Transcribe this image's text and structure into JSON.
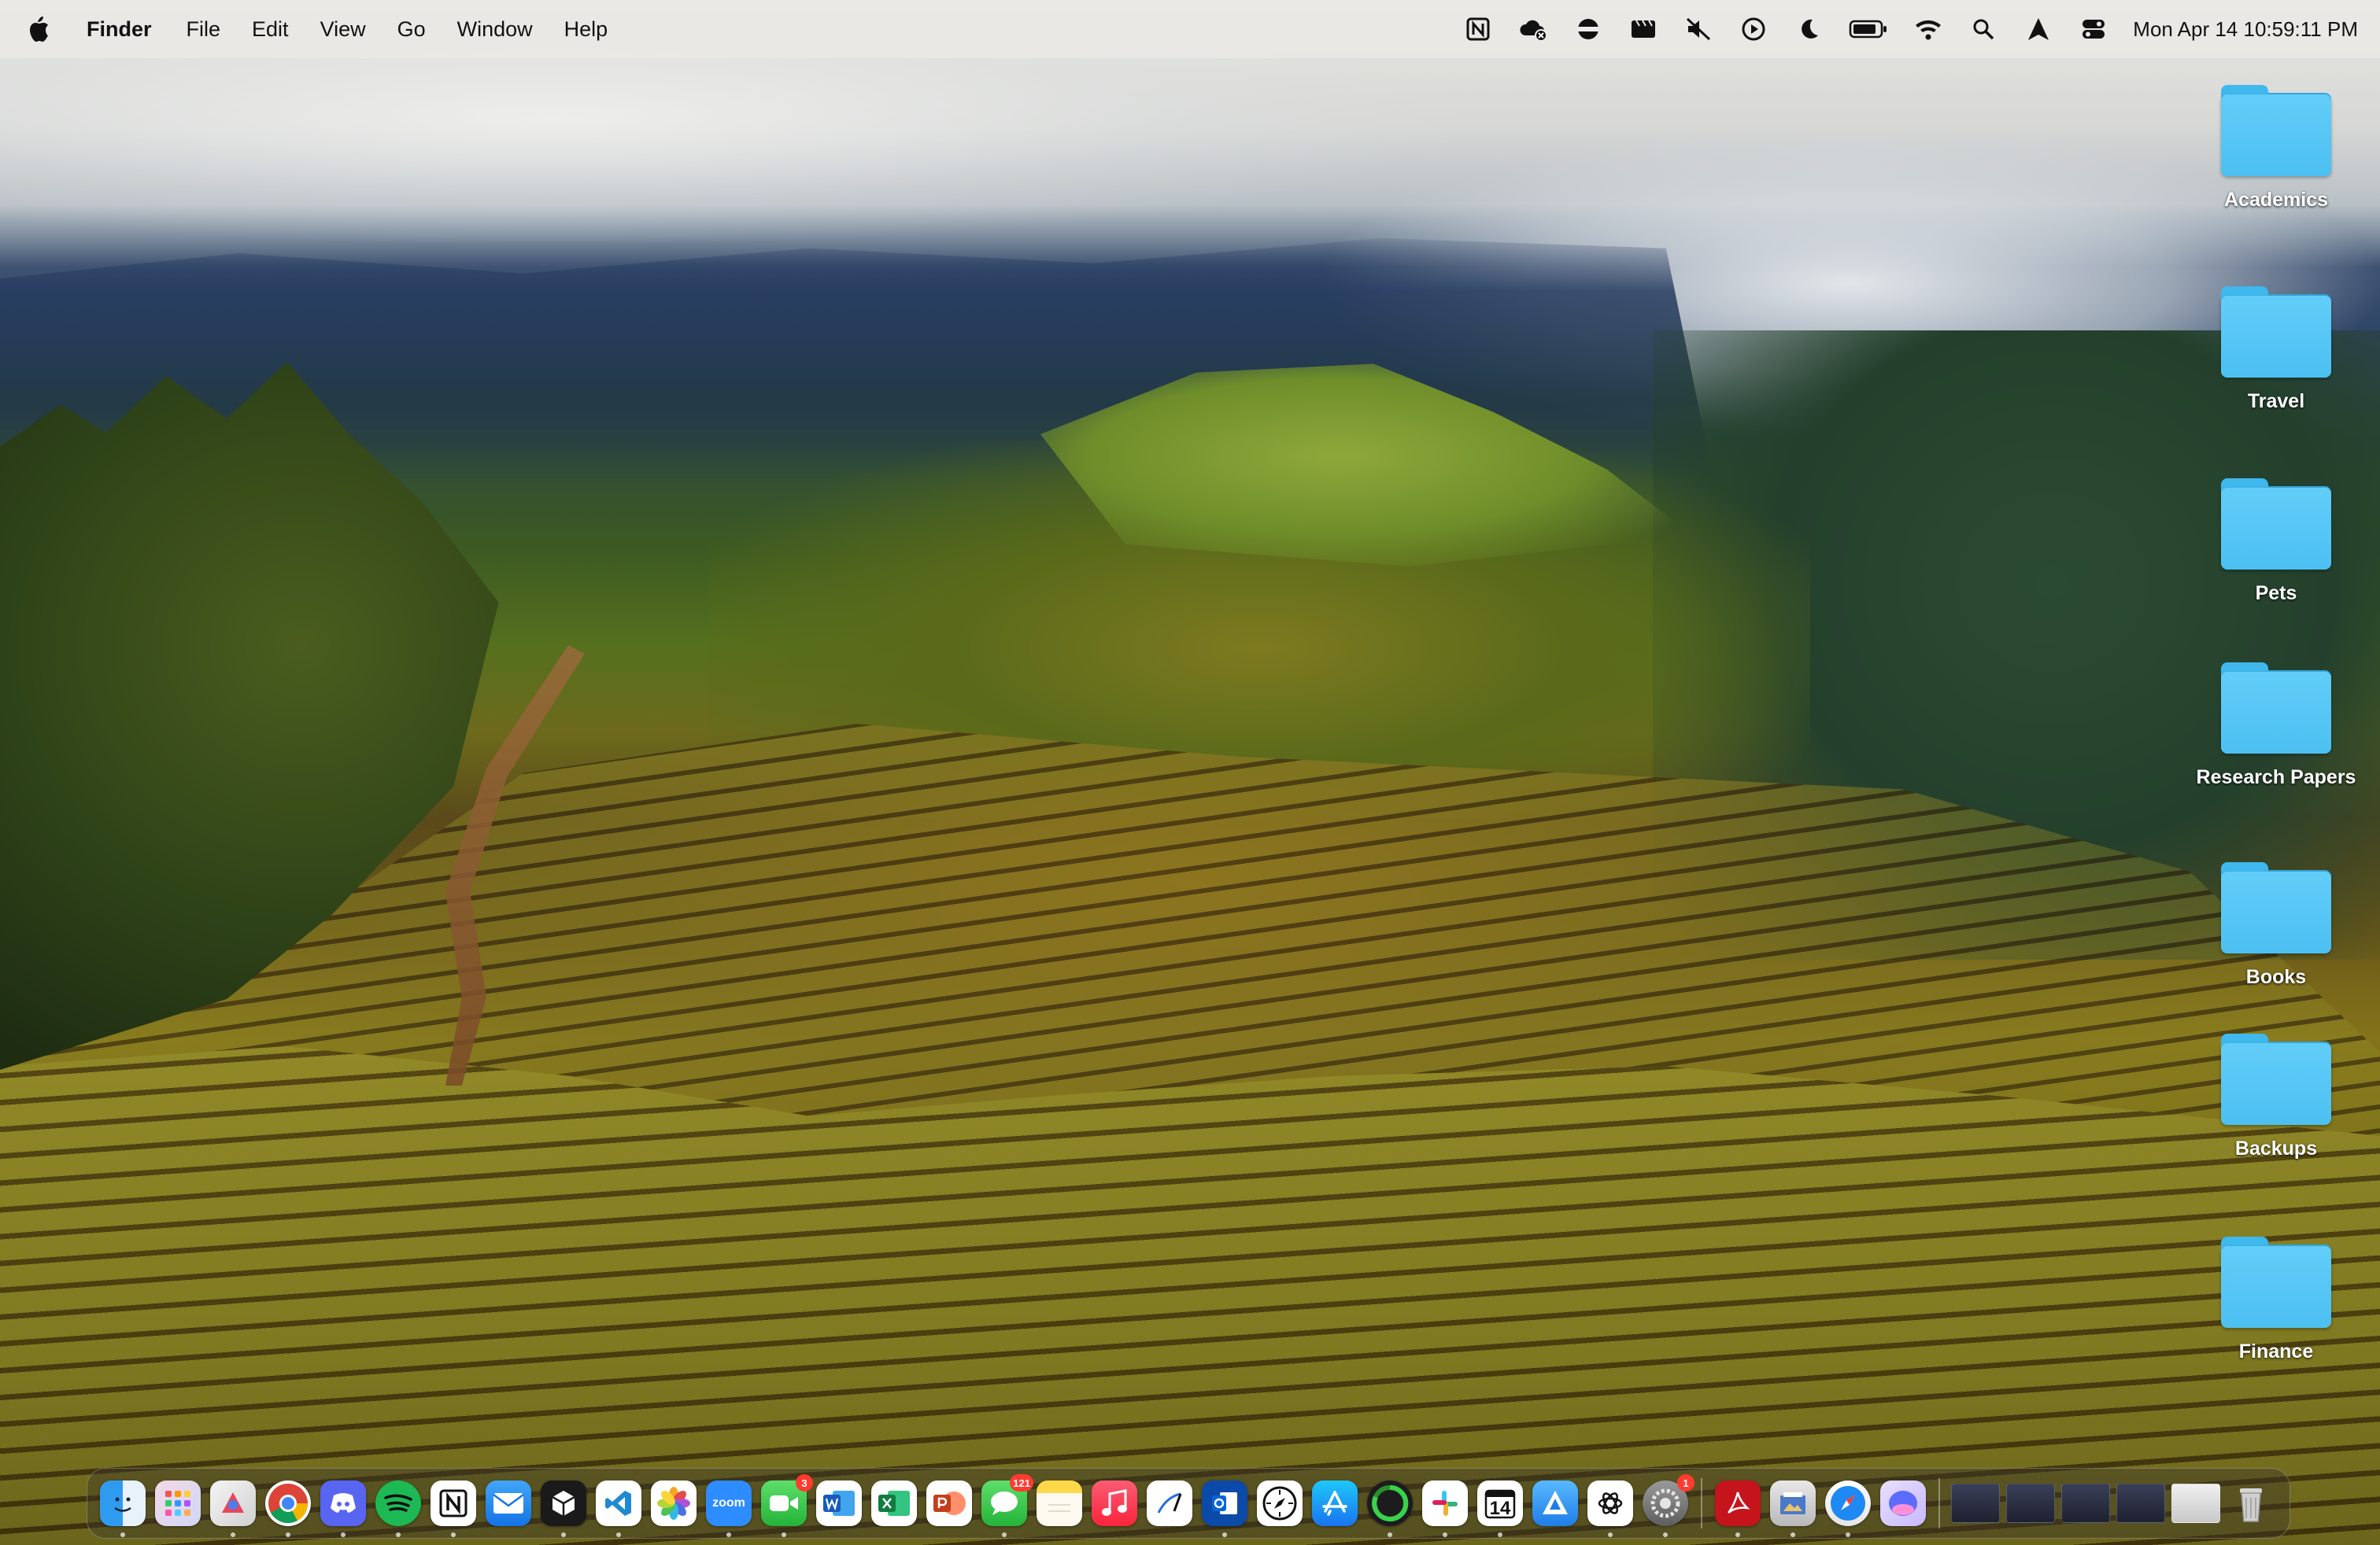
{
  "menubar": {
    "app_name": "Finder",
    "items": [
      "File",
      "Edit",
      "View",
      "Go",
      "Window",
      "Help"
    ],
    "clock": "Mon Apr 14  10:59:11 PM"
  },
  "desktop": {
    "folders": [
      "Academics",
      "Travel",
      "Pets",
      "Research Papers",
      "Books",
      "Backups",
      "Finance"
    ]
  },
  "dock": {
    "zoom_label": "zoom",
    "calendar_day": "14",
    "facetime_badge": "3",
    "messages_badge": "121",
    "settings_badge": "1"
  },
  "colors": {
    "folder_blue": "#4cc0f2",
    "badge_red": "#ff3b30"
  }
}
